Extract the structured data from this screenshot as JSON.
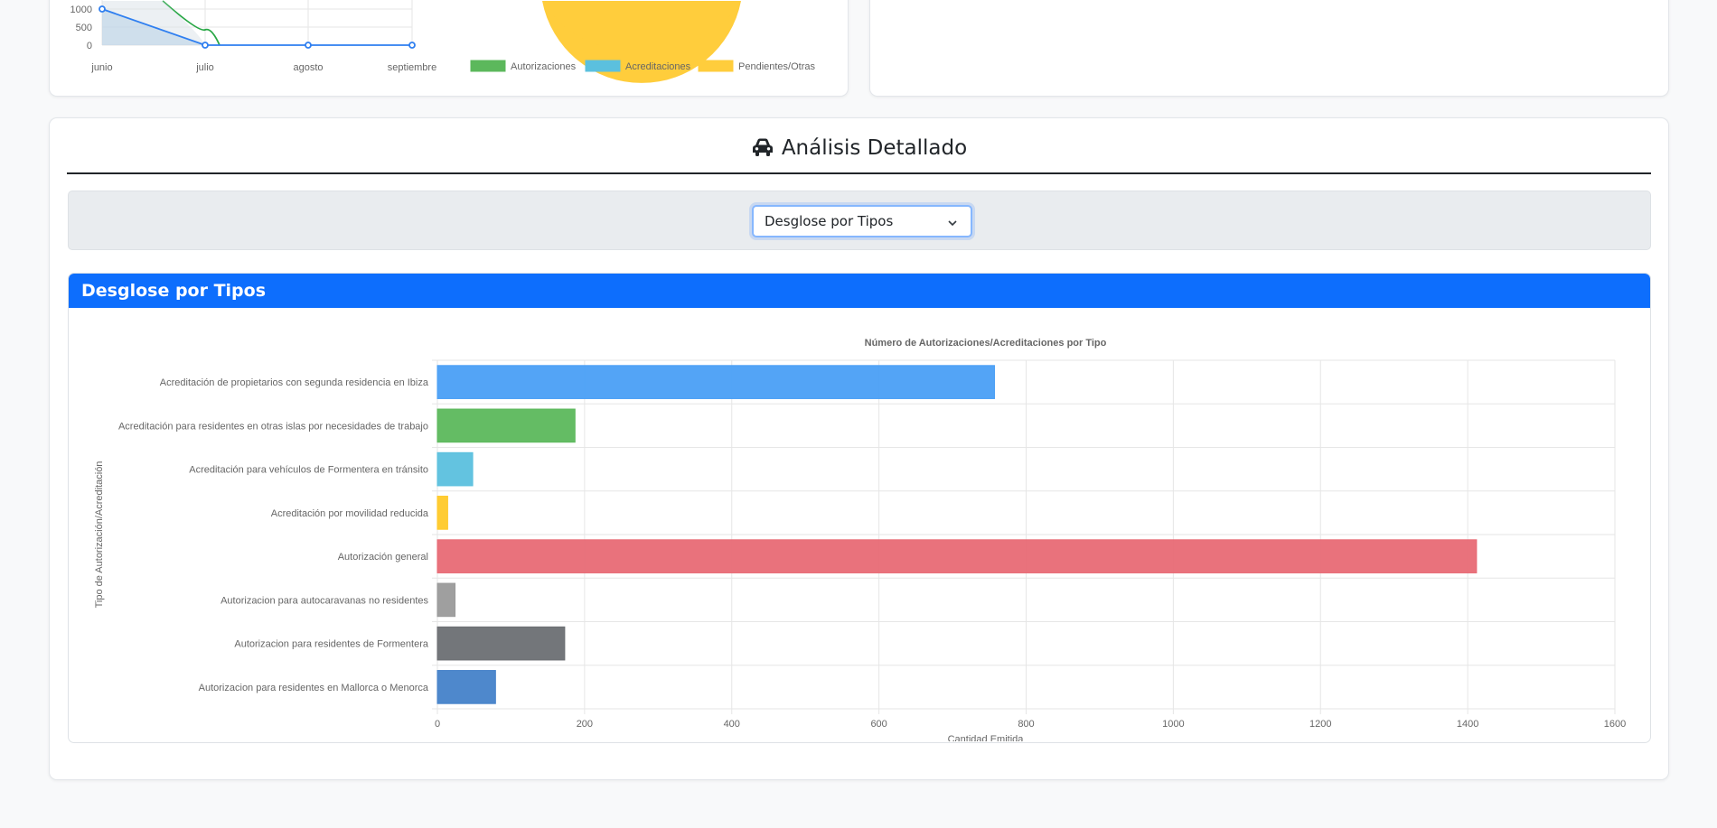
{
  "top_left_chart": {
    "x_labels": [
      "junio",
      "julio",
      "agosto",
      "septiembre"
    ],
    "y_ticks": [
      "1000",
      "500",
      "0"
    ],
    "legend": [
      {
        "label": "Autorizaciones",
        "color": "#5cb85c"
      },
      {
        "label": "Acreditaciones",
        "color": "#5bc0de"
      },
      {
        "label": "Pendientes/Otras",
        "color": "#ffcd3c"
      }
    ]
  },
  "analysis": {
    "title": "Análisis Detallado",
    "icon": "car-icon",
    "select_value": "Desglose por Tipos",
    "panel_title": "Desglose por Tipos"
  },
  "chart_data": {
    "type": "bar",
    "orientation": "horizontal",
    "title": "Número de Autorizaciones/Acreditaciones por Tipo",
    "xlabel": "Cantidad Emitida",
    "ylabel": "Tipo de Autorización/Acreditación",
    "xlim": [
      0,
      1600
    ],
    "x_ticks": [
      "0",
      "200",
      "400",
      "600",
      "800",
      "1000",
      "1200",
      "1400",
      "1600"
    ],
    "grid": true,
    "categories": [
      "Acreditación de propietarios con segunda residencia en Ibiza",
      "Acreditación para residentes en otras islas por necesidades de trabajo",
      "Acreditación para vehículos de Formentera en tránsito",
      "Acreditación por movilidad reducida",
      "Autorización general",
      "Autorizacion para autocaravanas no residentes",
      "Autorizacion para residentes de Formentera",
      "Autorizacion para residentes en Mallorca o Menorca"
    ],
    "values": [
      757,
      187,
      48,
      14,
      1412,
      24,
      173,
      79
    ],
    "colors": [
      "#4a9ff5",
      "#5cb85c",
      "#5bc0de",
      "#ffc928",
      "#e86a75",
      "#9a9a9a",
      "#6c6f73",
      "#4582c9"
    ]
  }
}
